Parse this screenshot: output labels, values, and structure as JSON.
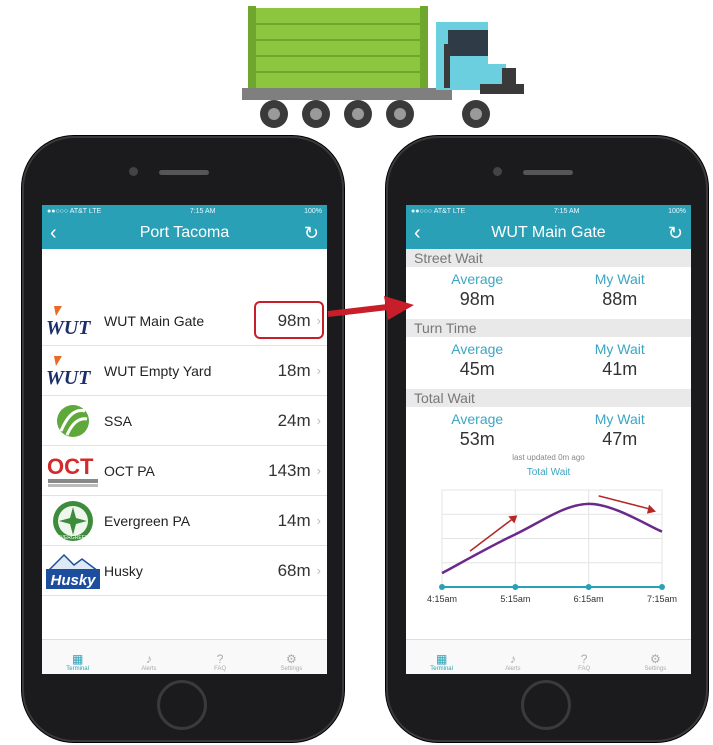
{
  "colors": {
    "teal": "#2aa0b7",
    "accent_blue": "#3aa6c4",
    "red": "#c81e2a",
    "purple": "#6a2a8c"
  },
  "left": {
    "status": {
      "carrier": "●●○○○ AT&T  LTE",
      "time": "7:15 AM",
      "battery": "100%"
    },
    "title": "Port Tacoma",
    "terminals": [
      {
        "logo": "WUT",
        "name": "WUT Main Gate",
        "wait": "98m"
      },
      {
        "logo": "WUT",
        "name": "WUT Empty Yard",
        "wait": "18m"
      },
      {
        "logo": "SSA",
        "name": "SSA",
        "wait": "24m"
      },
      {
        "logo": "OCT",
        "name": "OCT PA",
        "wait": "143m"
      },
      {
        "logo": "EVERGREEN",
        "name": "Evergreen PA",
        "wait": "14m"
      },
      {
        "logo": "Husky",
        "name": "Husky",
        "wait": "68m"
      }
    ]
  },
  "tabs": [
    {
      "label": "Terminal",
      "icon": "terminal-icon"
    },
    {
      "label": "Alerts",
      "icon": "bell-icon"
    },
    {
      "label": "FAQ",
      "icon": "question-icon"
    },
    {
      "label": "Settings",
      "icon": "gear-icon"
    }
  ],
  "right": {
    "status": {
      "carrier": "●●○○○ AT&T  LTE",
      "time": "7:15 AM",
      "battery": "100%"
    },
    "title": "WUT Main Gate",
    "average_label": "Average",
    "mywait_label": "My Wait",
    "street": {
      "header": "Street Wait",
      "average": "98m",
      "mywait": "88m"
    },
    "turn": {
      "header": "Turn Time",
      "average": "45m",
      "mywait": "41m"
    },
    "total": {
      "header": "Total Wait",
      "average": "53m",
      "mywait": "47m"
    },
    "updated": "last updated 0m ago",
    "chart_title": "Total Wait"
  },
  "chart_data": {
    "type": "line",
    "title": "Total Wait",
    "x": [
      "4:15am",
      "5:15am",
      "6:15am",
      "7:15am"
    ],
    "series": [
      {
        "values": [
          10,
          38,
          60,
          40
        ]
      }
    ],
    "grid": true
  }
}
